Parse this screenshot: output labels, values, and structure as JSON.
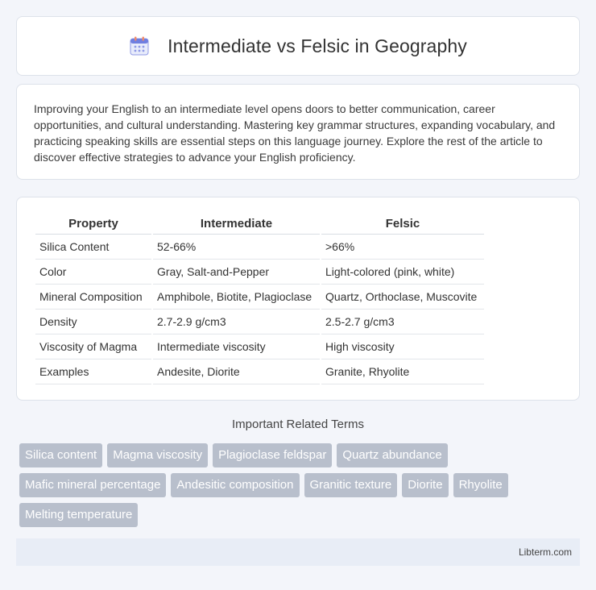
{
  "header": {
    "title": "Intermediate vs Felsic in Geography",
    "icon": "calendar-icon"
  },
  "intro": {
    "text": "Improving your English to an intermediate level opens doors to better communication, career opportunities, and cultural understanding. Mastering key grammar structures, expanding vocabulary, and practicing speaking skills are essential steps on this language journey. Explore the rest of the article to discover effective strategies to advance your English proficiency."
  },
  "table": {
    "headers": [
      "Property",
      "Intermediate",
      "Felsic"
    ],
    "rows": [
      [
        "Silica Content",
        "52-66%",
        ">66%"
      ],
      [
        "Color",
        "Gray, Salt-and-Pepper",
        "Light-colored (pink, white)"
      ],
      [
        "Mineral Composition",
        "Amphibole, Biotite, Plagioclase",
        "Quartz, Orthoclase, Muscovite"
      ],
      [
        "Density",
        "2.7-2.9 g/cm3",
        "2.5-2.7 g/cm3"
      ],
      [
        "Viscosity of Magma",
        "Intermediate viscosity",
        "High viscosity"
      ],
      [
        "Examples",
        "Andesite, Diorite",
        "Granite, Rhyolite"
      ]
    ]
  },
  "terms": {
    "heading": "Important Related Terms",
    "items": [
      "Silica content",
      "Magma viscosity",
      "Plagioclase feldspar",
      "Quartz abundance",
      "Mafic mineral percentage",
      "Andesitic composition",
      "Granitic texture",
      "Diorite",
      "Rhyolite",
      "Melting temperature"
    ]
  },
  "footer": {
    "text": "Libterm.com"
  },
  "colors": {
    "background": "#f3f5fa",
    "tag": "#b8bfcc",
    "footer": "#e8edf6"
  }
}
